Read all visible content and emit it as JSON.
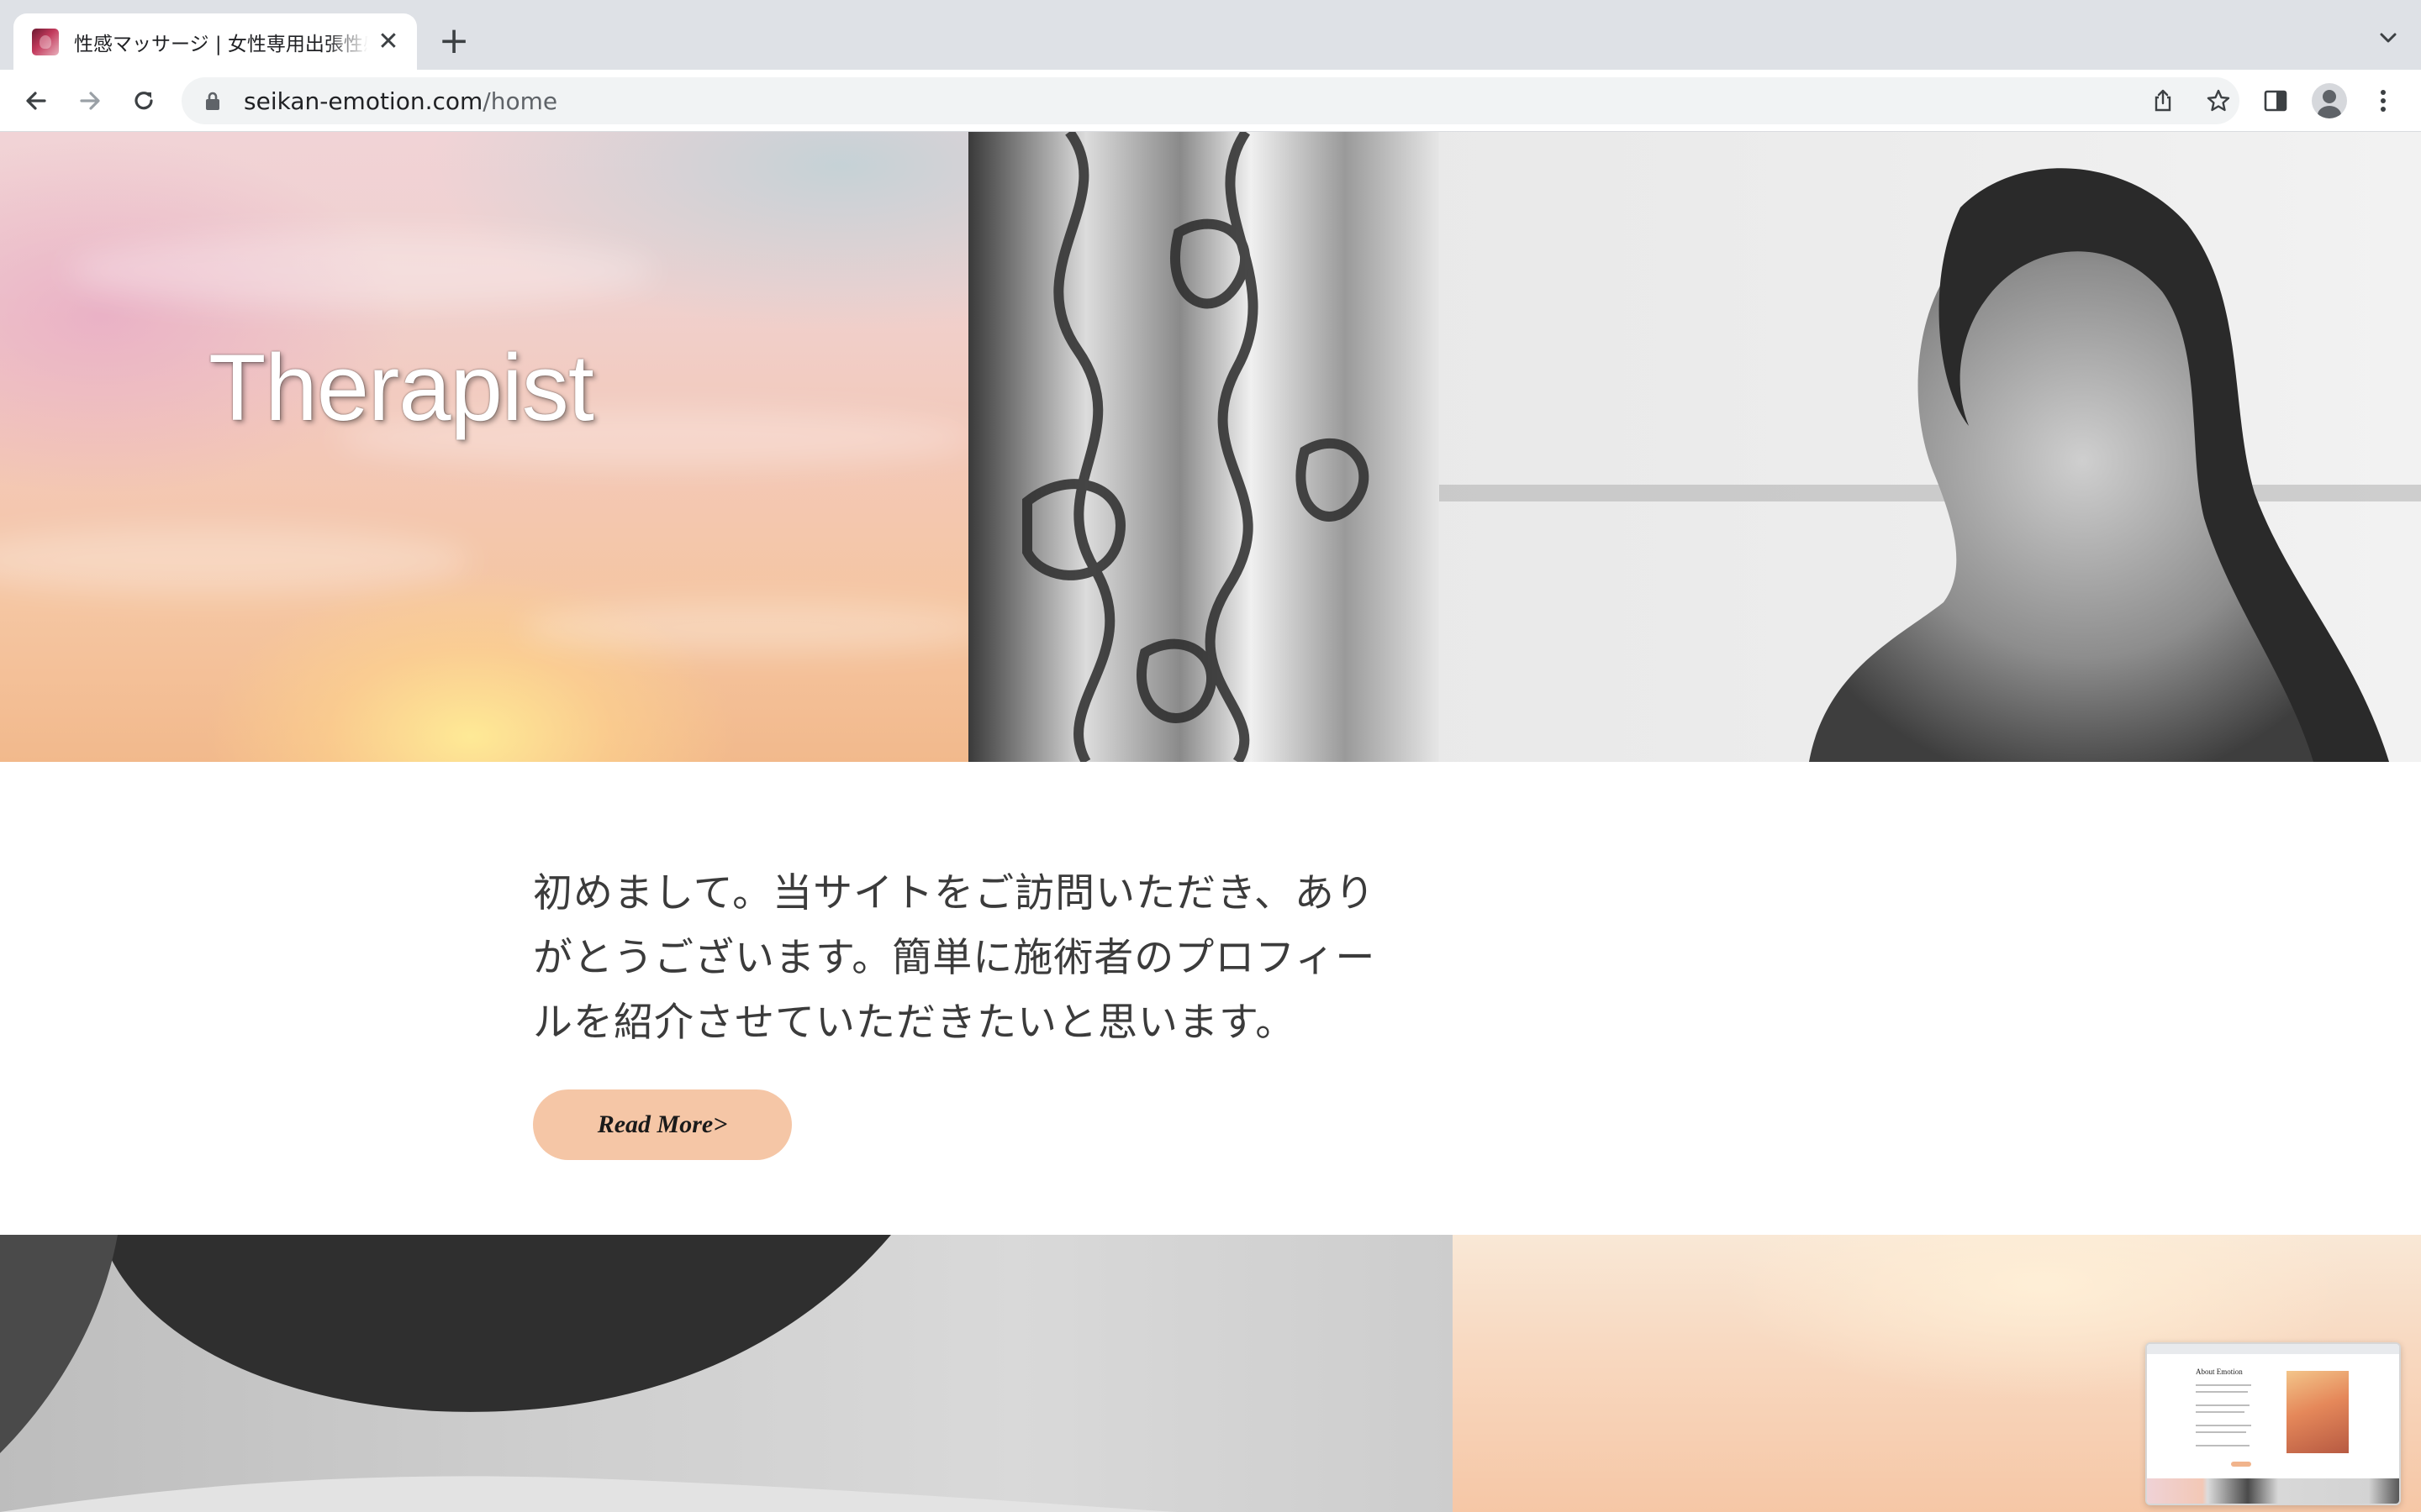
{
  "browser": {
    "tab": {
      "title": "性感マッサージ | 女性専用出張性感",
      "favicon": "rose-favicon-icon"
    },
    "new_tab_label": "+",
    "close_tab_label": "✕",
    "address": {
      "domain": "seikan-emotion.com",
      "path": "/home"
    }
  },
  "hero": {
    "title": "Therapist"
  },
  "intro": {
    "line1": "初めまして。当サイトをご訪問いただき、あり",
    "line2": "がとうございます。簡単に施術者のプロフィー",
    "line3": "ルを紹介させていただきたいと思います。",
    "read_more_label": "Read More>"
  },
  "preview_thumbnail": {
    "title": "About Emotion"
  },
  "colors": {
    "button": "#f5c6a6",
    "text": "#3b3b3b",
    "tabstrip": "#dee1e6"
  }
}
